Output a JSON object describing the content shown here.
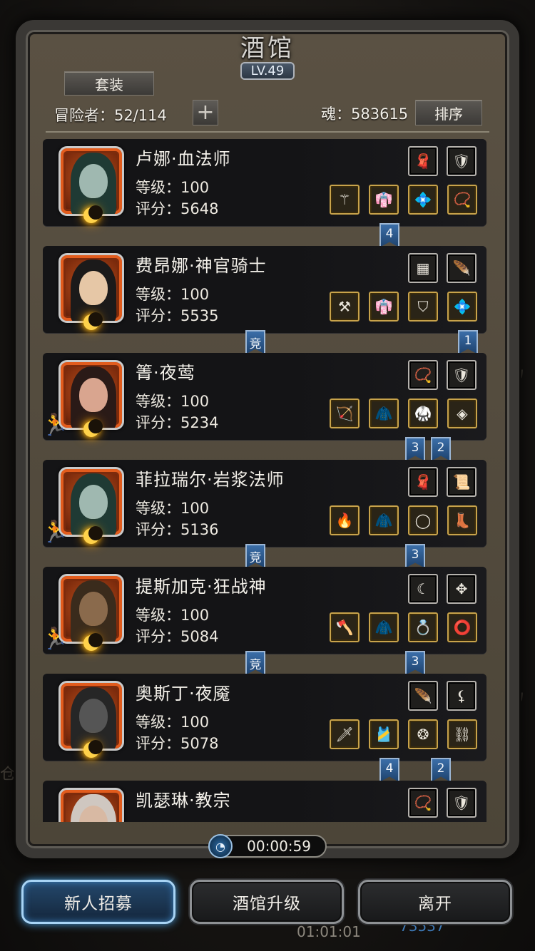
{
  "window": {
    "title": "酒馆",
    "level": "LV.49"
  },
  "toolbar": {
    "set_label": "套装",
    "adventurers_label": "冒险者：52/114",
    "soul_label": "魂：583615",
    "sort_label": "排序"
  },
  "heroes": [
    {
      "name": "卢娜·血法师",
      "level_label": "等级：100",
      "score_label": "评分：5648",
      "runner": false,
      "top_icons": [
        "red-hood-icon",
        "blue-armor-icon"
      ],
      "bottom_icons": [
        "staff-icon",
        "robe-icon",
        "crystal-armor-icon",
        "amulet-icon"
      ],
      "ribbons": [
        {
          "text": "4"
        }
      ]
    },
    {
      "name": "费昂娜·神官骑士",
      "level_label": "等级：100",
      "score_label": "评分：5535",
      "runner": false,
      "top_icons": [
        "chainmail-icon",
        "feather-icon"
      ],
      "bottom_icons": [
        "hammer-icon",
        "robe-icon",
        "chest-plate-icon",
        "crystal-armor-icon"
      ],
      "ribbons": [
        {
          "text": "竞"
        },
        {
          "text": "1"
        }
      ]
    },
    {
      "name": "箐·夜莺",
      "level_label": "等级：100",
      "score_label": "评分：5234",
      "runner": true,
      "top_icons": [
        "necklace-icon",
        "blue-armor-icon"
      ],
      "bottom_icons": [
        "bow-icon",
        "dark-cloak-icon",
        "dark-robe-icon",
        "rune-gem-icon"
      ],
      "ribbons": [
        {
          "text": "3"
        },
        {
          "text": "2"
        }
      ]
    },
    {
      "name": "菲拉瑞尔·岩浆法师",
      "level_label": "等级：100",
      "score_label": "评分：5136",
      "runner": true,
      "top_icons": [
        "red-hood-icon",
        "green-scroll-icon"
      ],
      "bottom_icons": [
        "fire-staff-icon",
        "dark-cloak-icon",
        "jade-ring-icon",
        "boots-icon"
      ],
      "ribbons": [
        {
          "text": "竞"
        },
        {
          "text": "3"
        }
      ]
    },
    {
      "name": "提斯加克·狂战神",
      "level_label": "等级：100",
      "score_label": "评分：5084",
      "runner": true,
      "top_icons": [
        "horn-icon",
        "emblem-icon"
      ],
      "bottom_icons": [
        "axe-icon",
        "dark-cloak-icon",
        "sapphire-ring-icon",
        "gold-ring-icon"
      ],
      "ribbons": [
        {
          "text": "竞"
        },
        {
          "text": "3"
        }
      ]
    },
    {
      "name": "奥斯丁·夜魇",
      "level_label": "等级：100",
      "score_label": "评分：5078",
      "runner": false,
      "top_icons": [
        "white-feather-icon",
        "claw-icon"
      ],
      "bottom_icons": [
        "dagger-icon",
        "red-robe-icon",
        "emerald-ring-icon",
        "bracer-icon"
      ],
      "ribbons": [
        {
          "text": "4"
        },
        {
          "text": "2"
        }
      ]
    },
    {
      "name": "凯瑟琳·教宗",
      "level_label": "",
      "score_label": "",
      "runner": false,
      "top_icons": [
        "necklace-icon",
        "blue-armor-icon"
      ],
      "bottom_icons": [],
      "ribbons": []
    }
  ],
  "timer": {
    "value": "00:00:59"
  },
  "actions": {
    "recruit": "新人招募",
    "upgrade": "酒馆升级",
    "leave": "离开"
  },
  "background": {
    "hud_time": "01:01:01",
    "hud_value": "73537",
    "side_char_1": "杨",
    "side_char_2": "仓",
    "side_char_3": "杨"
  },
  "colors": {
    "frame": "#4c4538",
    "card": "#141416",
    "ribbon": "#2b5a8e",
    "gold_border": "#c8a34b"
  }
}
